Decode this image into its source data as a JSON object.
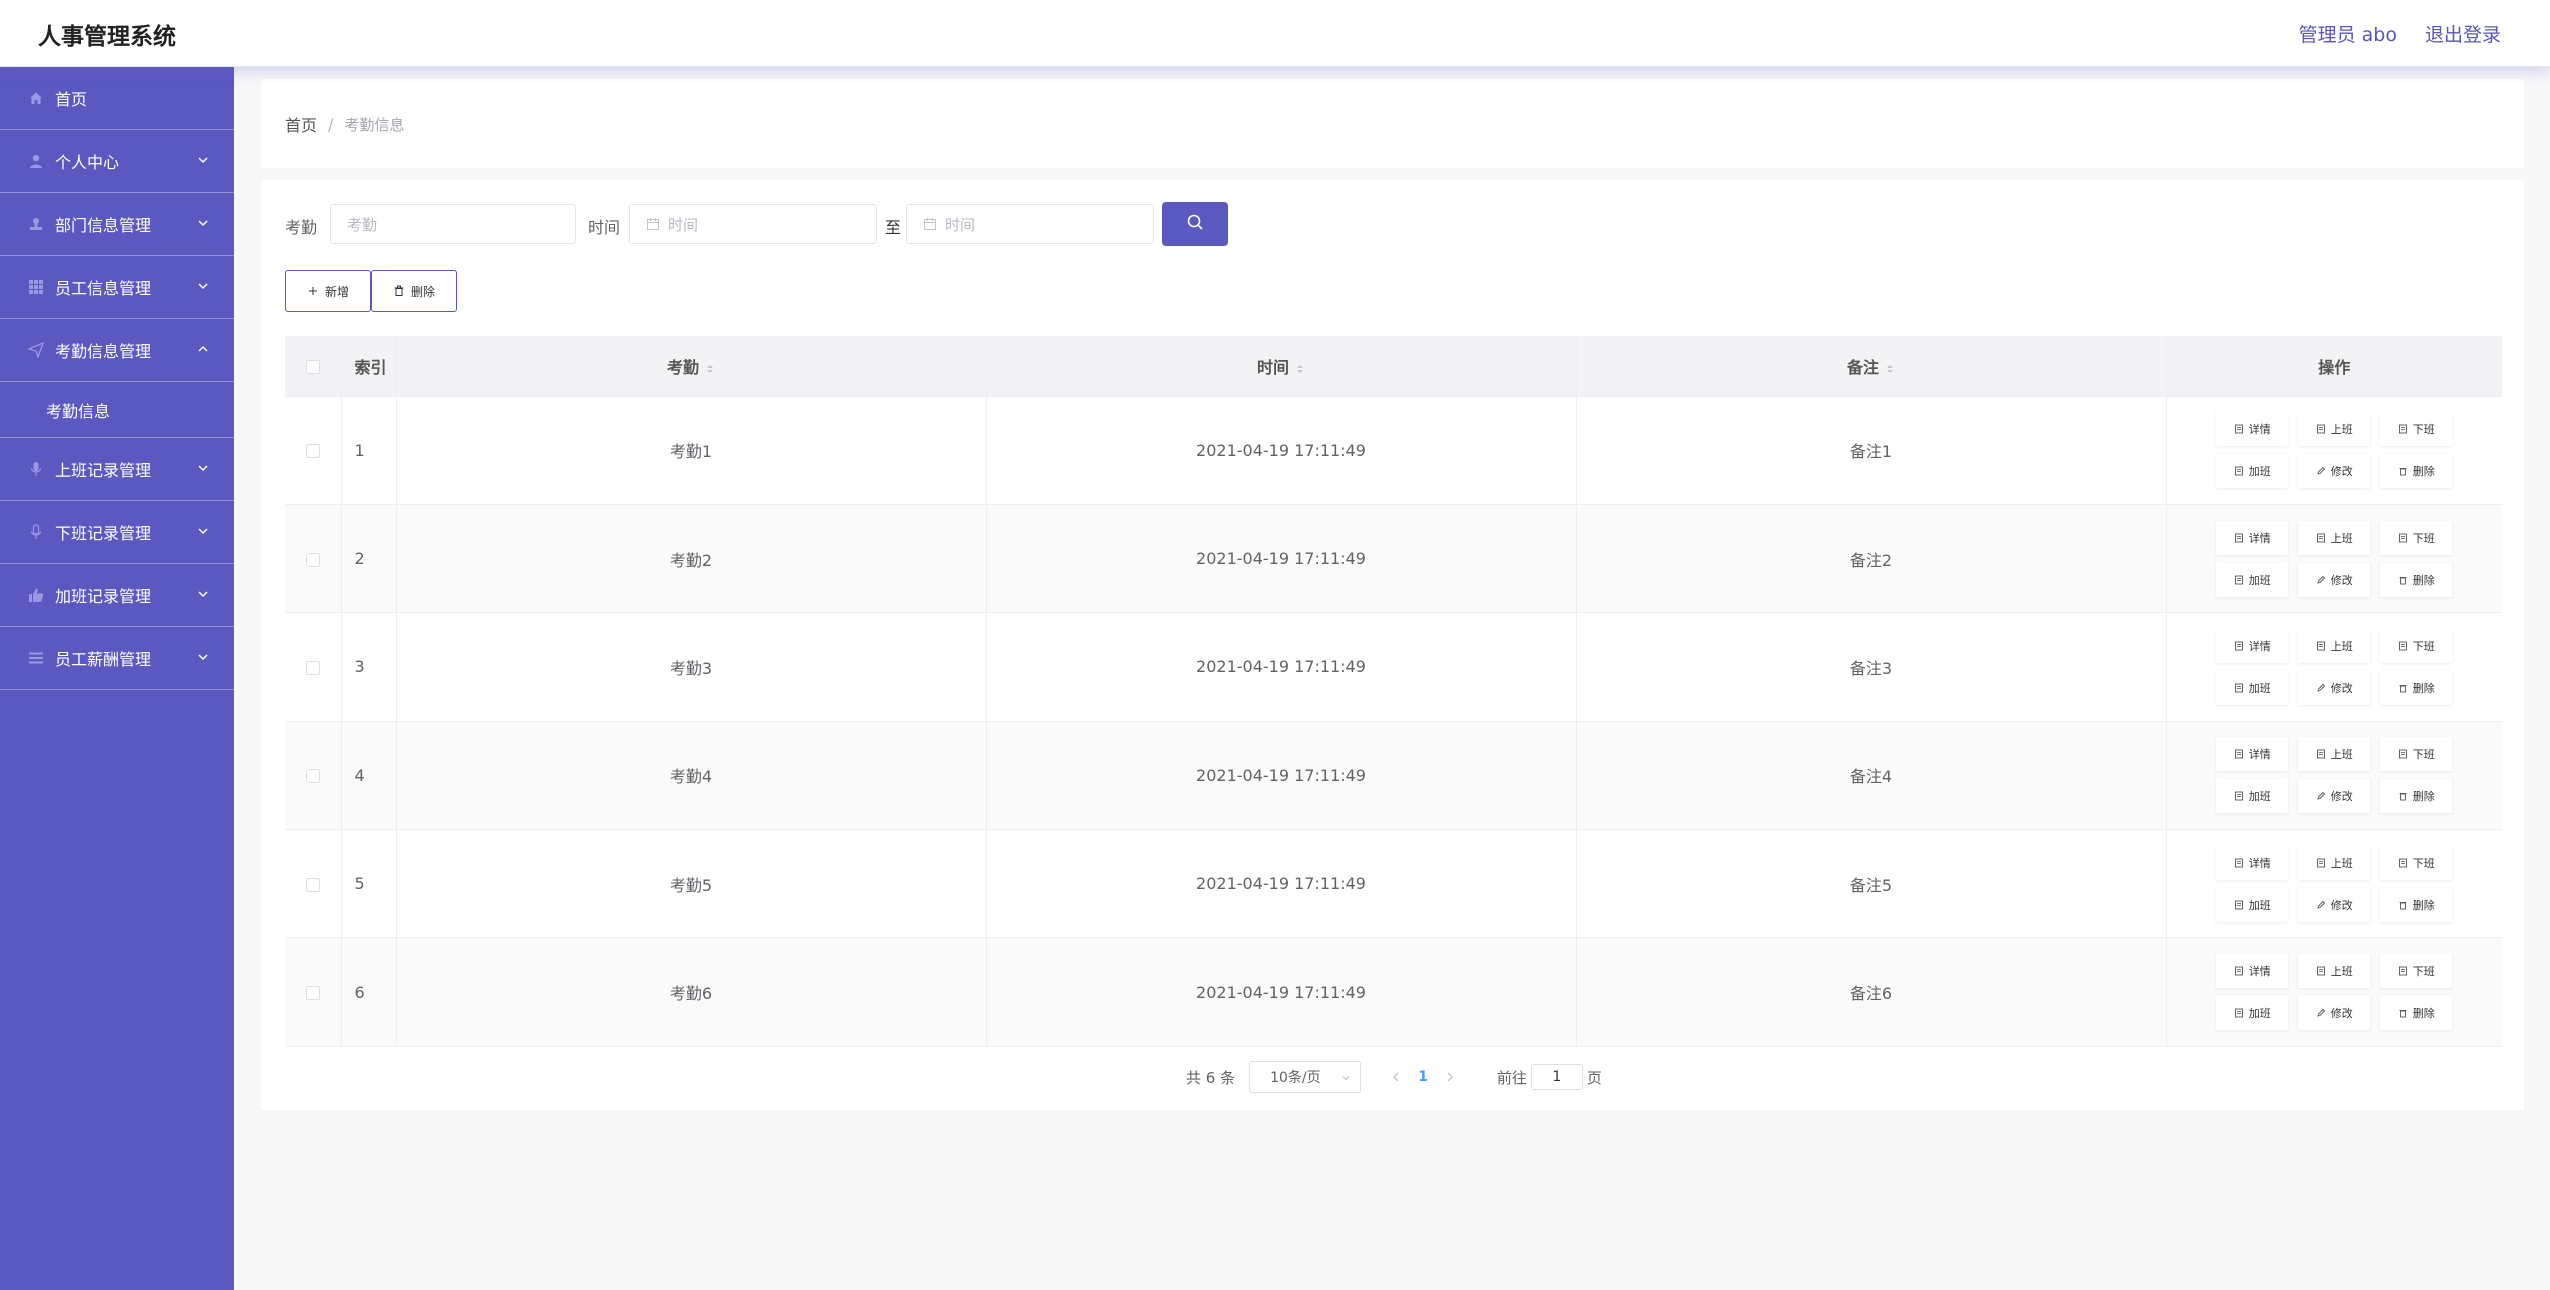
{
  "header": {
    "title": "人事管理系统",
    "admin": "管理员 abo",
    "logout": "退出登录"
  },
  "sidebar": {
    "items": [
      {
        "label": "首页",
        "icon": "home-icon",
        "chevron": "none"
      },
      {
        "label": "个人中心",
        "icon": "user-icon",
        "chevron": "down"
      },
      {
        "label": "部门信息管理",
        "icon": "stamp-icon",
        "chevron": "down"
      },
      {
        "label": "员工信息管理",
        "icon": "grid-icon",
        "chevron": "down"
      },
      {
        "label": "考勤信息管理",
        "icon": "send-icon",
        "chevron": "up"
      },
      {
        "label": "上班记录管理",
        "icon": "mic-icon",
        "chevron": "down"
      },
      {
        "label": "下班记录管理",
        "icon": "mic-icon",
        "chevron": "down"
      },
      {
        "label": "加班记录管理",
        "icon": "thumb-icon",
        "chevron": "down"
      },
      {
        "label": "员工薪酬管理",
        "icon": "list-icon",
        "chevron": "down"
      }
    ],
    "submenu": {
      "label": "考勤信息"
    }
  },
  "breadcrumb": {
    "home": "首页",
    "separator": "/",
    "current": "考勤信息"
  },
  "search": {
    "kq_label": "考勤",
    "kq_placeholder": "考勤",
    "time_label": "时间",
    "time_start_placeholder": "时间",
    "to_label": "至",
    "time_end_placeholder": "时间"
  },
  "actions": {
    "add": "新增",
    "delete": "删除"
  },
  "table": {
    "headers": {
      "index": "索引",
      "kq": "考勤",
      "time": "时间",
      "note": "备注",
      "ops": "操作"
    },
    "op_labels": [
      "详情",
      "上班",
      "下班",
      "加班",
      "修改",
      "删除"
    ],
    "rows": [
      {
        "index": "1",
        "kq": "考勤1",
        "time": "2021-04-19 17:11:49",
        "note": "备注1"
      },
      {
        "index": "2",
        "kq": "考勤2",
        "time": "2021-04-19 17:11:49",
        "note": "备注2"
      },
      {
        "index": "3",
        "kq": "考勤3",
        "time": "2021-04-19 17:11:49",
        "note": "备注3"
      },
      {
        "index": "4",
        "kq": "考勤4",
        "time": "2021-04-19 17:11:49",
        "note": "备注4"
      },
      {
        "index": "5",
        "kq": "考勤5",
        "time": "2021-04-19 17:11:49",
        "note": "备注5"
      },
      {
        "index": "6",
        "kq": "考勤6",
        "time": "2021-04-19 17:11:49",
        "note": "备注6"
      }
    ]
  },
  "pagination": {
    "total": "共 6 条",
    "page_size": "10条/页",
    "current_page": "1",
    "goto_label": "前往",
    "goto_value": "1",
    "page_unit": "页"
  },
  "colors": {
    "primary": "#5b58bf",
    "page_link": "#409eff"
  }
}
